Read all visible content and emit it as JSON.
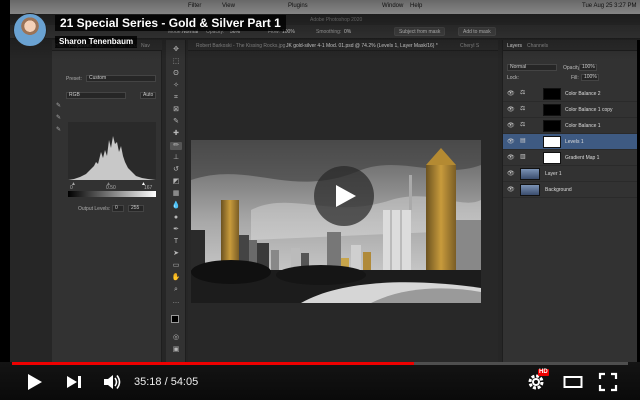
{
  "video": {
    "title": "21 Special Series - Gold & Silver Part 1",
    "channel": "Sharon Tenenbaum",
    "time_current": "35:18",
    "time_total": "54:05",
    "time_display": "35:18 / 54:05",
    "progress": 0.6527,
    "hd_label": "HD"
  },
  "menubar": {
    "items": [
      "Filter",
      "View",
      "Plugins",
      "Window",
      "Help"
    ],
    "clock": "Tue Aug 25  3:27 PM",
    "app_title": "Adobe Photoshop 2020"
  },
  "options_bar": {
    "mode_label": "Mode:",
    "mode_value": "Normal",
    "opacity_label": "Opacity:",
    "opacity_value": "56%",
    "flow_label": "Flow:",
    "flow_value": "100%",
    "smoothing_label": "Smoothing:",
    "smoothing_value": "0%",
    "subject_button": "Subject from mask",
    "add_mask_button": "Add to mask"
  },
  "properties": {
    "tabs": [
      "Hist",
      "Properties",
      "Pat",
      "Ch",
      "Sh",
      "Bru",
      "Nav"
    ],
    "preset_label": "Preset:",
    "preset_value": "Custom",
    "channel_value": "RGB",
    "auto_label": "Auto",
    "input_black": "0",
    "input_gamma": "0.50",
    "input_white": "167",
    "output_label": "Output Levels:",
    "output_black": "0",
    "output_white": "255"
  },
  "document": {
    "tabs": [
      "Robert Barkoski - The Kissing Rocks.jpg",
      "JK gold-silver 4-1 Mod. 01.psd @ 74.2% (Levels 1, Layer Mask/16) *",
      "Cheryl S"
    ]
  },
  "layers": {
    "tabs": [
      "Layers",
      "Channels"
    ],
    "kind_value": "Normal",
    "opacity_label": "Opacity:",
    "opacity_value": "100%",
    "lock_label": "Lock:",
    "fill_label": "Fill:",
    "fill_value": "100%",
    "rows": [
      {
        "name": "Color Balance 2",
        "type": "adjust"
      },
      {
        "name": "Color Balance 1 copy",
        "type": "adjust"
      },
      {
        "name": "Color Balance 1",
        "type": "adjust"
      },
      {
        "name": "Levels 1",
        "type": "levels",
        "selected": true
      },
      {
        "name": "Gradient Map 1",
        "type": "gradient"
      },
      {
        "name": "Layer 1",
        "type": "pixel"
      },
      {
        "name": "Background",
        "type": "pixel"
      }
    ]
  },
  "icons": {
    "play": "play-icon",
    "next": "next-icon",
    "volume": "volume-icon",
    "settings": "settings-icon",
    "theater": "theater-mode-icon",
    "fullscreen": "fullscreen-icon",
    "eye": "eye-icon"
  },
  "colors": {
    "youtube_red": "#ff0000",
    "layer_selected": "#3e5a82",
    "ps_panel": "#323232"
  }
}
